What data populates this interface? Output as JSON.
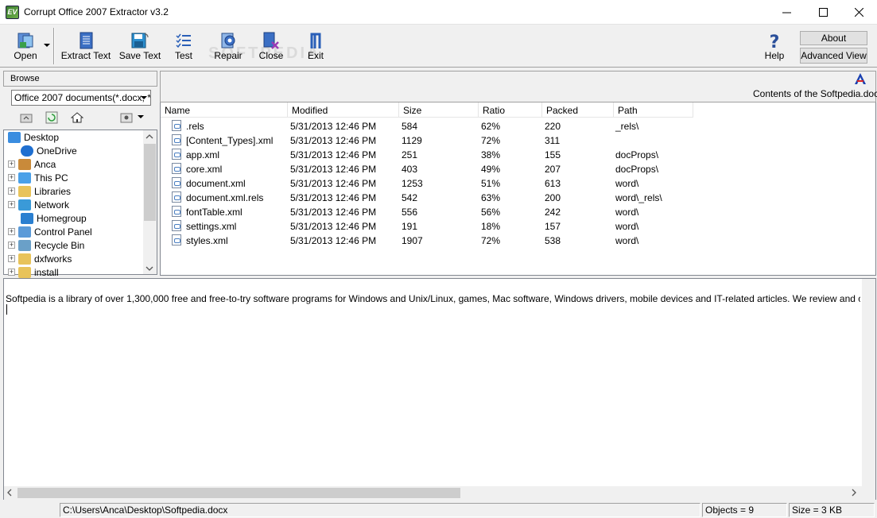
{
  "window": {
    "title": "Corrupt Office 2007 Extractor v3.2",
    "app_icon_text": "EV"
  },
  "toolbar": {
    "open": "Open",
    "extract_text": "Extract Text",
    "save_text": "Save Text",
    "test": "Test",
    "repair": "Repair",
    "close": "Close",
    "exit": "Exit",
    "help": "Help",
    "about": "About",
    "advanced_view": "Advanced View",
    "watermark": "SOFTPEDIA"
  },
  "browse": {
    "header": "Browse",
    "filter_value": "Office 2007 documents(*.docx, *",
    "tree": [
      {
        "label": "Desktop",
        "icon": "desktop-icon",
        "expander": ""
      },
      {
        "label": "OneDrive",
        "icon": "cloud-icon",
        "expander": ""
      },
      {
        "label": "Anca",
        "icon": "user-icon",
        "expander": "+"
      },
      {
        "label": "This PC",
        "icon": "computer-icon",
        "expander": "+"
      },
      {
        "label": "Libraries",
        "icon": "folder-icon",
        "expander": "+"
      },
      {
        "label": "Network",
        "icon": "network-icon",
        "expander": "+"
      },
      {
        "label": "Homegroup",
        "icon": "homegroup-icon",
        "expander": ""
      },
      {
        "label": "Control Panel",
        "icon": "control-panel-icon",
        "expander": "+"
      },
      {
        "label": "Recycle Bin",
        "icon": "recycle-bin-icon",
        "expander": "+"
      },
      {
        "label": "dxfworks",
        "icon": "folder-icon",
        "expander": "+"
      },
      {
        "label": "install",
        "icon": "folder-icon",
        "expander": "+"
      }
    ]
  },
  "contents_label": "Contents of the Softpedia.docx",
  "file_list": {
    "columns": [
      "Name",
      "Modified",
      "Size",
      "Ratio",
      "Packed",
      "Path"
    ],
    "rows": [
      {
        "name": ".rels",
        "modified": "5/31/2013  12:46 PM",
        "size": "584",
        "ratio": "62%",
        "packed": "220",
        "path": "_rels\\"
      },
      {
        "name": "[Content_Types].xml",
        "modified": "5/31/2013  12:46 PM",
        "size": "1129",
        "ratio": "72%",
        "packed": "311",
        "path": ""
      },
      {
        "name": "app.xml",
        "modified": "5/31/2013  12:46 PM",
        "size": "251",
        "ratio": "38%",
        "packed": "155",
        "path": "docProps\\"
      },
      {
        "name": "core.xml",
        "modified": "5/31/2013  12:46 PM",
        "size": "403",
        "ratio": "49%",
        "packed": "207",
        "path": "docProps\\"
      },
      {
        "name": "document.xml",
        "modified": "5/31/2013  12:46 PM",
        "size": "1253",
        "ratio": "51%",
        "packed": "613",
        "path": "word\\"
      },
      {
        "name": "document.xml.rels",
        "modified": "5/31/2013  12:46 PM",
        "size": "542",
        "ratio": "63%",
        "packed": "200",
        "path": "word\\_rels\\"
      },
      {
        "name": "fontTable.xml",
        "modified": "5/31/2013  12:46 PM",
        "size": "556",
        "ratio": "56%",
        "packed": "242",
        "path": "word\\"
      },
      {
        "name": "settings.xml",
        "modified": "5/31/2013  12:46 PM",
        "size": "191",
        "ratio": "18%",
        "packed": "157",
        "path": "word\\"
      },
      {
        "name": "styles.xml",
        "modified": "5/31/2013  12:46 PM",
        "size": "1907",
        "ratio": "72%",
        "packed": "538",
        "path": "word\\"
      }
    ]
  },
  "text_area": {
    "content": "Softpedia is a library of over 1,300,000 free and free-to-try software programs for Windows and Unix/Linux, games, Mac software, Windows drivers, mobile devices and IT-related articles. We review and categorize these products"
  },
  "status": {
    "path": "C:\\Users\\Anca\\Desktop\\Softpedia.docx",
    "objects": "Objects = 9",
    "size": "Size = 3 KB"
  }
}
